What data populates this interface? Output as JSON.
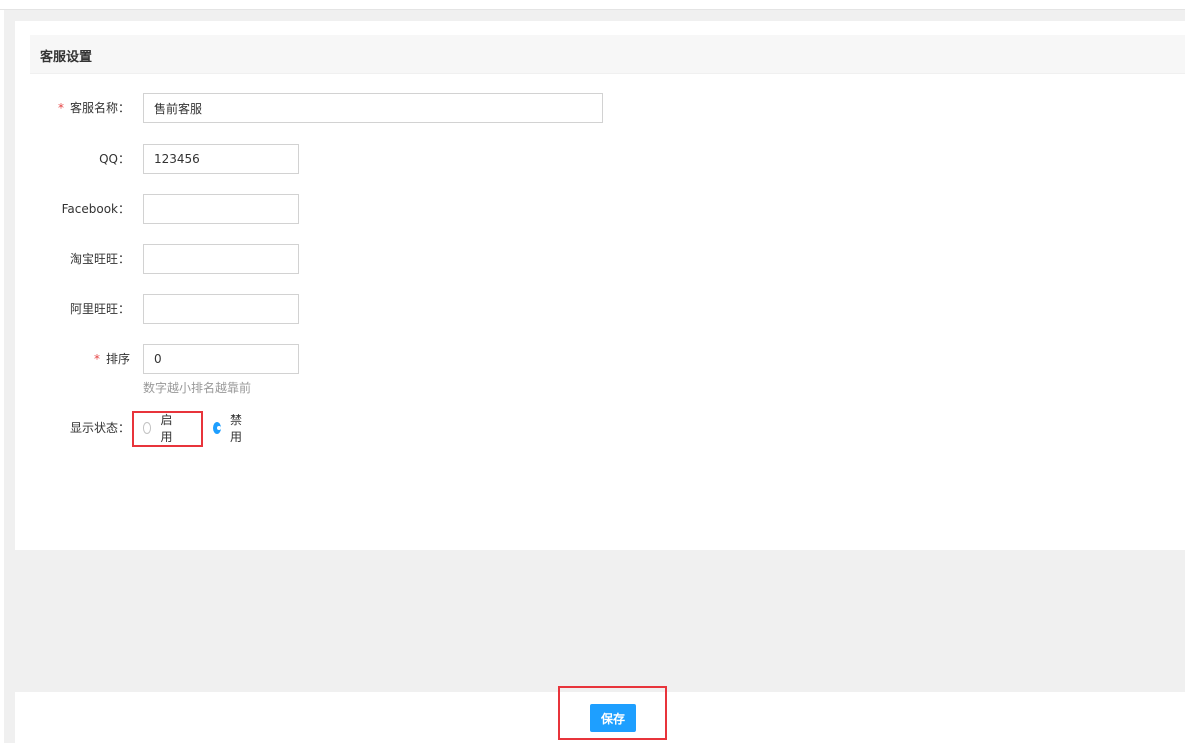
{
  "page": {
    "title": "客服设置"
  },
  "form": {
    "name": {
      "label": "客服名称：",
      "required_mark": "*",
      "value": "售前客服"
    },
    "qq": {
      "label": "QQ：",
      "value": "123456"
    },
    "facebook": {
      "label": "Facebook：",
      "value": ""
    },
    "taobao": {
      "label": "淘宝旺旺：",
      "value": ""
    },
    "alibaba": {
      "label": "阿里旺旺：",
      "value": ""
    },
    "sort": {
      "label": "排序",
      "required_mark": "*",
      "value": "0",
      "hint": "数字越小排名越靠前"
    },
    "status": {
      "label": "显示状态：",
      "options": [
        {
          "label": "启用",
          "selected": false
        },
        {
          "label": "禁用",
          "selected": true
        }
      ]
    }
  },
  "footer": {
    "save_label": "保存"
  },
  "colors": {
    "primary": "#1e9fff",
    "required": "#e54545",
    "highlight": "#e8343b"
  }
}
